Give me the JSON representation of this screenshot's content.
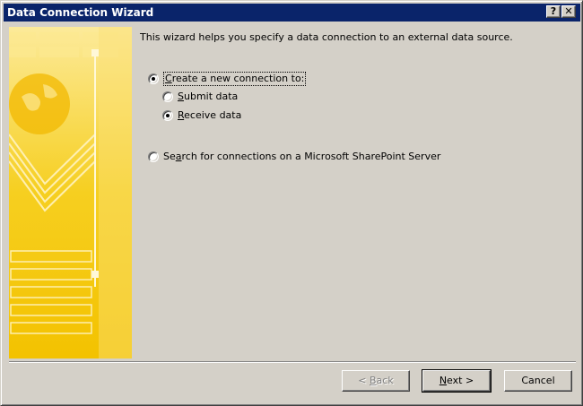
{
  "window": {
    "title": "Data Connection Wizard",
    "help_button": "?",
    "close_button": "✕"
  },
  "intro_text": "This wizard helps you specify a data connection to an external data source.",
  "options": {
    "create_new": {
      "mnemonic": "C",
      "rest": "reate a new connection to:",
      "selected": true
    },
    "submit": {
      "mnemonic": "S",
      "rest": "ubmit data",
      "selected": false
    },
    "receive": {
      "mnemonic": "R",
      "rest": "eceive data",
      "selected": true
    },
    "search": {
      "prefix": "Se",
      "mnemonic": "a",
      "rest": "rch for connections on a Microsoft SharePoint Server",
      "selected": false
    }
  },
  "buttons": {
    "back_prefix": "< ",
    "back_mnemonic": "B",
    "back_rest": "ack",
    "next_mnemonic": "N",
    "next_rest": "ext >",
    "cancel": "Cancel"
  },
  "colors": {
    "titlebar": "#0a246a",
    "dialog": "#d4d0c8",
    "banner_yellow": "#f7d12a"
  }
}
